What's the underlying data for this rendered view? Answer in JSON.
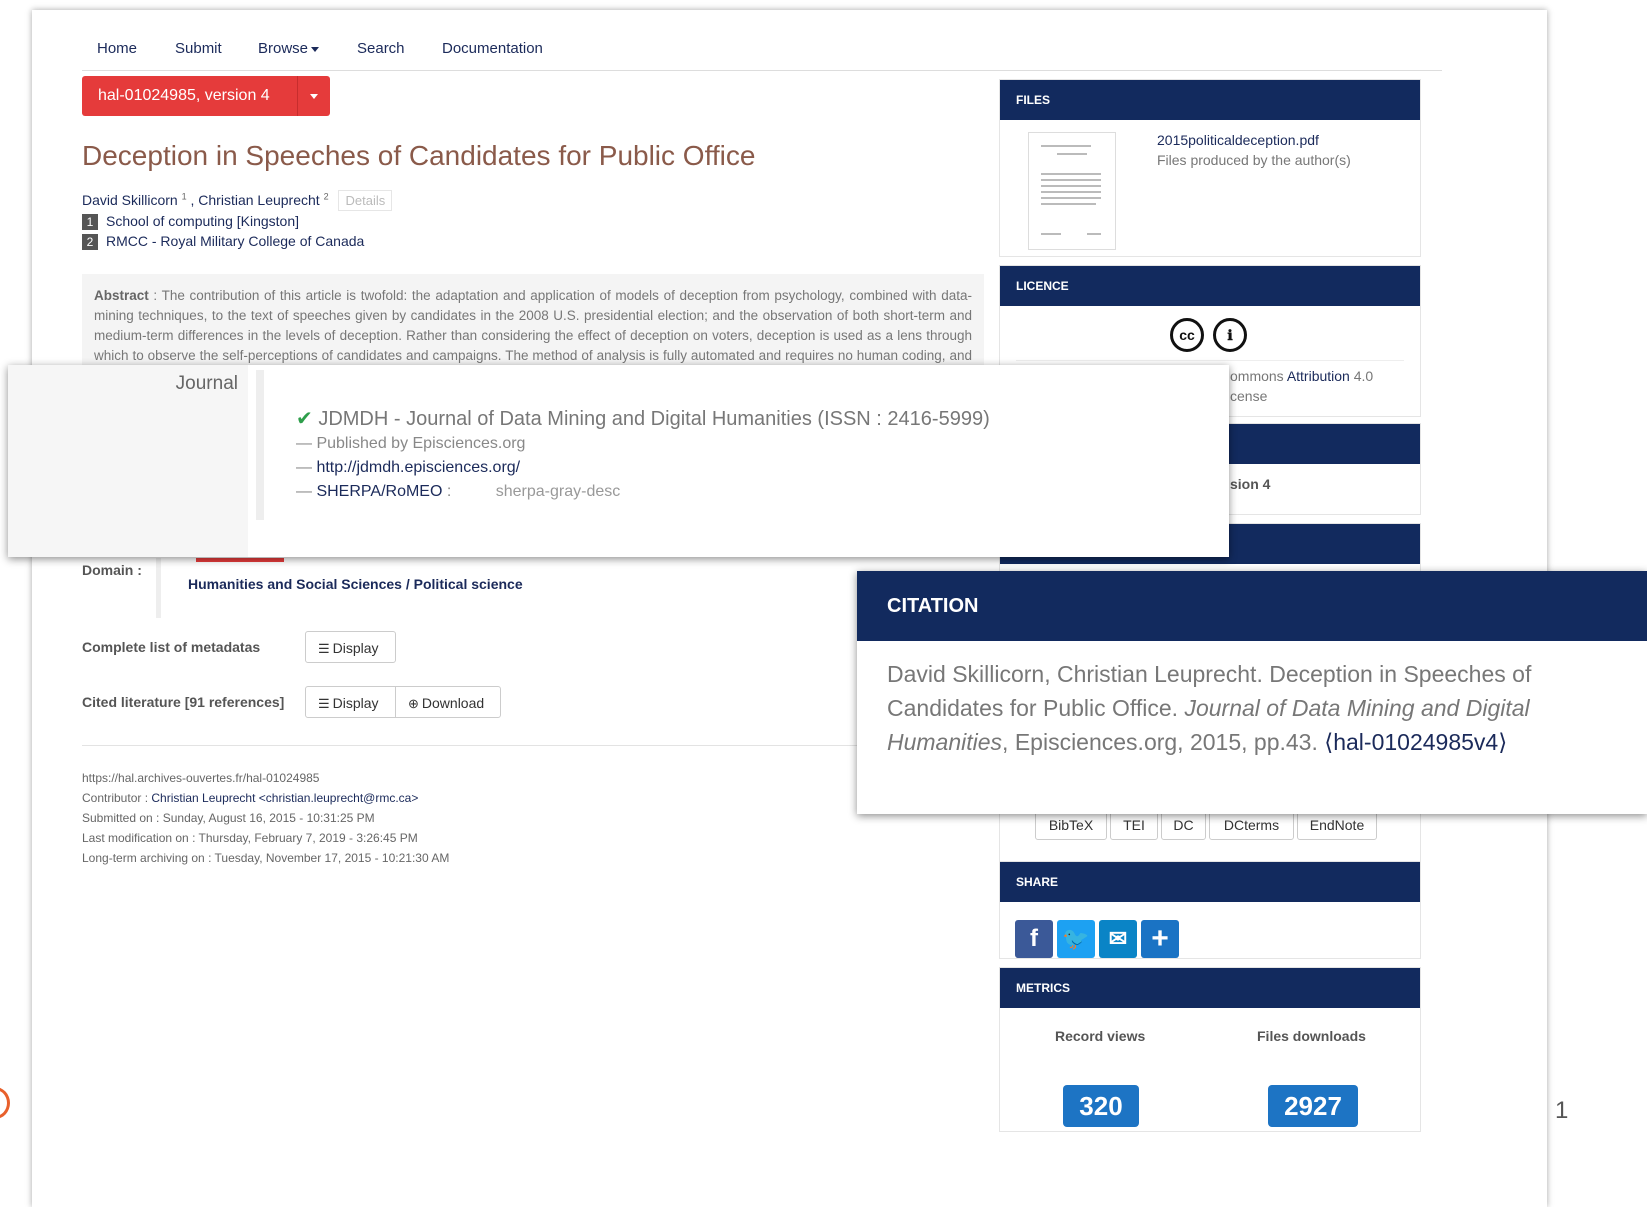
{
  "nav": {
    "items": [
      "Home",
      "Submit",
      "Browse",
      "Search",
      "Documentation"
    ]
  },
  "version_button": "hal-01024985, version 4",
  "title": "Deception in Speeches of Candidates for Public Office",
  "authors": {
    "a1": "David Skillicorn",
    "a1_sup": "1",
    "sep": " , ",
    "a2": "Christian Leuprecht",
    "a2_sup": "2",
    "details": "Details"
  },
  "affiliations": [
    {
      "num": "1",
      "name": "School of computing [Kingston]"
    },
    {
      "num": "2",
      "name": "RMCC - Royal Military College of Canada"
    }
  ],
  "abstract": {
    "label": "Abstract",
    "text": " : The contribution of this article is twofold: the adaptation and application of models of deception from psychology, combined with data-mining techniques, to the text of speeches given by candidates in the 2008 U.S. presidential election; and the observation of both short-term and medium-term differences in the levels of deception. Rather than considering the effect of deception on voters, deception is used as a lens through which to observe the self-perceptions of candidates and campaigns. The method of analysis is fully automated and requires no human coding, and so can be applied to many other domains in a straightforward way. The authors posit"
  },
  "journal": {
    "label": "Journal",
    "name": "JDMDH - Journal of Data Mining and Digital Humanities (ISSN : 2416-5999)",
    "publisher": "— Published by Episciences.org",
    "url_prefix": "— ",
    "url": "http://jdmdh.episciences.org/",
    "sherpa_prefix": "— ",
    "sherpa_label": "SHERPA/RoMEO",
    "sherpa_sep": " :",
    "sherpa_value": "sherpa-gray-desc"
  },
  "domain": {
    "label": "Domain :",
    "value1": "Humanities and Social Sciences",
    "sep": " / ",
    "value2": "Political science"
  },
  "metadata": {
    "label": "Complete list of metadatas",
    "display": "Display"
  },
  "cited": {
    "label": "Cited literature [91 references]",
    "display": "Display",
    "download": "Download"
  },
  "footer": {
    "url": "https://hal.archives-ouvertes.fr/hal-01024985",
    "contributor_label": "Contributor : ",
    "contributor": "Christian Leuprecht <christian.leuprecht@rmc.ca>",
    "submitted": "Submitted on : Sunday, August 16, 2015 - 10:31:25 PM",
    "modified": "Last modification on : Thursday, February 7, 2019 - 3:26:45 PM",
    "archived": "Long-term archiving on : Tuesday, November 17, 2015 - 10:21:30 AM"
  },
  "files": {
    "header": "FILES",
    "filename": "2015politicaldeception.pdf",
    "desc": "Files produced by the author(s)"
  },
  "licence": {
    "header": "LICENCE",
    "text1": "ommons ",
    "text_link": "Attribution",
    "text2": " 4.0",
    "text3": "cense"
  },
  "identifiers": {
    "text": "sion 4"
  },
  "citation": {
    "header": "CITATION",
    "text1": "David Skillicorn, Christian Leuprecht. Deception in Speeches of Candidates for Public Office. ",
    "journal": "Journal of Data Mining and Digital Humanities",
    "text2": ", Episciences.org, 2015, pp.43. ",
    "link": "⟨hal-01024985v4⟩"
  },
  "export_formats": [
    "BibTeX",
    "TEI",
    "DC",
    "DCterms",
    "EndNote"
  ],
  "share": {
    "header": "SHARE",
    "icons": [
      "facebook-icon",
      "twitter-icon",
      "email-icon",
      "plus-icon"
    ]
  },
  "metrics": {
    "header": "METRICS",
    "views_label": "Record views",
    "views": "320",
    "downloads_label": "Files downloads",
    "downloads": "2927"
  },
  "page_number": "1",
  "colors": {
    "navy": "#122a5e",
    "red": "#e53b3b",
    "metric_blue": "#1d74c4",
    "facebook": "#3b5998",
    "twitter": "#1da1f2",
    "email": "#0a84c6",
    "plus": "#1a73c4"
  }
}
